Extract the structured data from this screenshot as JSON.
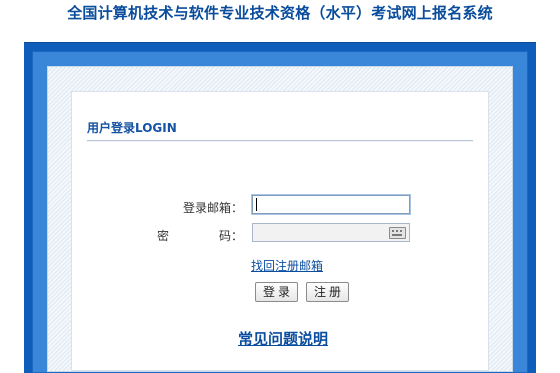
{
  "header": {
    "title": "全国计算机技术与软件专业技术资格（水平）考试网上报名系统"
  },
  "login_panel": {
    "title": "用户登录LOGIN",
    "email_label": "登录邮箱：",
    "password_label_left": "密",
    "password_label_right": "码：",
    "email_value": "",
    "password_value": "",
    "recover_link": "找回注册邮箱",
    "login_button": "登录",
    "register_button": "注册",
    "faq_link": "常见问题说明"
  },
  "icons": {
    "password_field": "keyboard-icon"
  },
  "colors": {
    "title": "#0a4c9c",
    "frame_blue": "#0f5dbb",
    "link": "#0b4ea0"
  }
}
